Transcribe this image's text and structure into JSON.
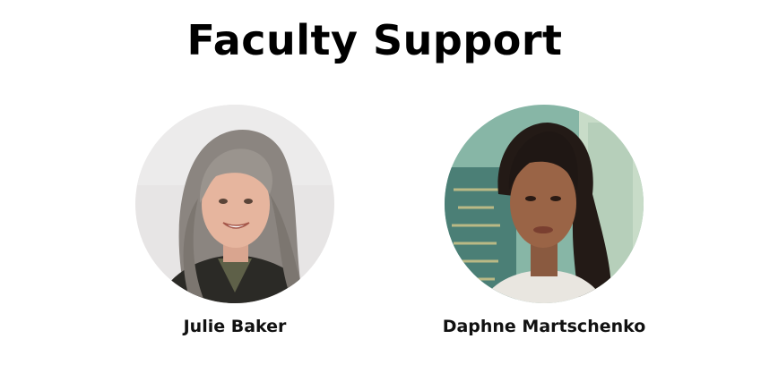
{
  "page": {
    "title": "Faculty Support"
  },
  "people": [
    {
      "name": "Julie Baker",
      "avatar_icon": "portrait-photo"
    },
    {
      "name": "Daphne Martschenko",
      "avatar_icon": "portrait-photo"
    }
  ],
  "colors": {
    "title": "#000000",
    "name": "#111111",
    "avatar1_bg": "#e6e4e4",
    "avatar2_bg": "#7fb2a3"
  }
}
